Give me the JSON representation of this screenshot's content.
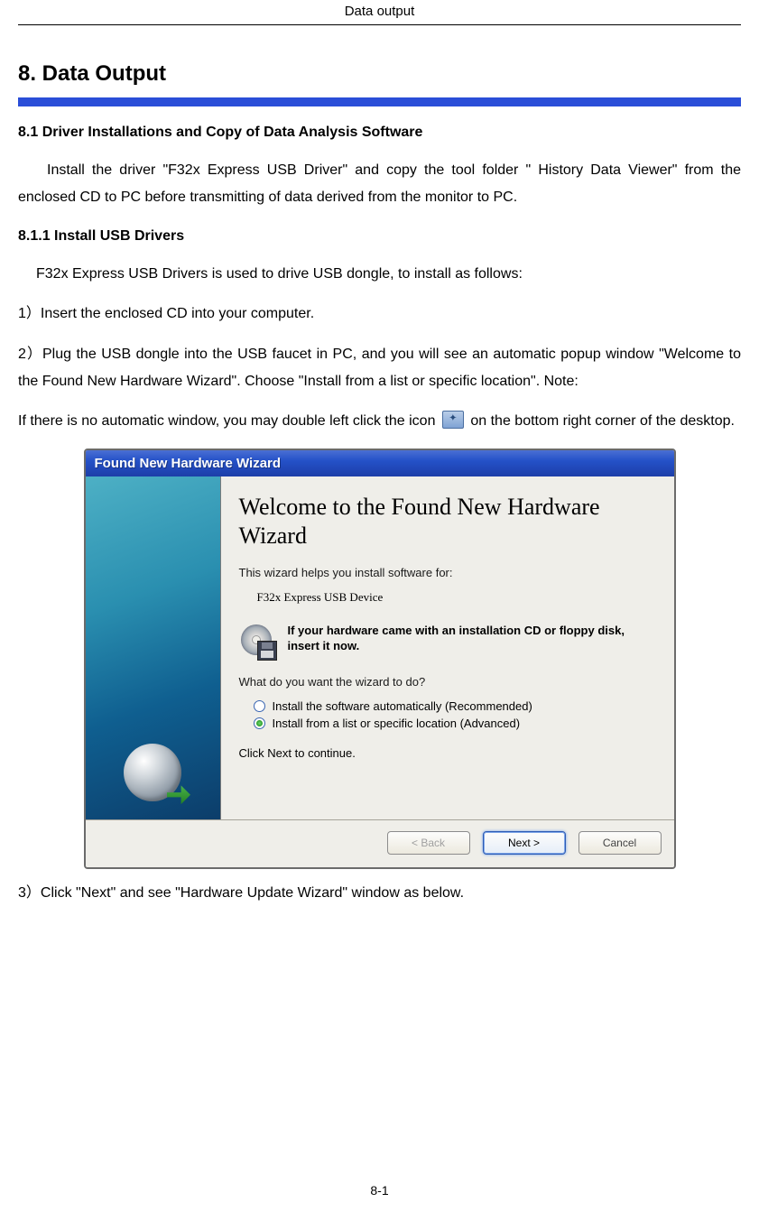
{
  "header": {
    "running_title": "Data output"
  },
  "footer": {
    "page_number": "8-1"
  },
  "section": {
    "title": "8. Data Output",
    "sub1": {
      "title": "8.1 Driver Installations and Copy of Data Analysis Software",
      "para1": "Install the driver \"F32x Express USB Driver\" and copy the tool folder \" History Data Viewer\" from the enclosed CD to PC before transmitting of data derived from the monitor to PC."
    },
    "sub1_1": {
      "title": "8.1.1 Install USB Drivers",
      "intro": "F32x Express USB Drivers is used to drive USB dongle, to install as follows:",
      "step1": "1）Insert the enclosed CD into your computer.",
      "step2": "2）Plug the USB dongle into the USB faucet in PC, and you will see an automatic popup window \"Welcome to the Found New Hardware Wizard\". Choose \"Install from a list or specific location\". Note:",
      "step2b_pre": "If there is no automatic window, you may double left click the icon ",
      "step2b_post": " on the bottom right corner of the desktop.",
      "step3": "3）Click \"Next\" and see \"Hardware Update Wizard\" window as below."
    }
  },
  "wizard": {
    "titlebar": "Found New Hardware Wizard",
    "heading": "Welcome to the Found New Hardware Wizard",
    "help_text": "This wizard helps you install software for:",
    "device_name": "F32x Express USB Device",
    "cd_note": "If your hardware came with an installation CD or floppy disk, insert it now.",
    "prompt": "What do you want the wizard to do?",
    "options": {
      "auto": "Install the software automatically (Recommended)",
      "list": "Install from a list or specific location (Advanced)"
    },
    "click_next": "Click Next to continue.",
    "buttons": {
      "back": "< Back",
      "next": "Next >",
      "cancel": "Cancel"
    }
  }
}
